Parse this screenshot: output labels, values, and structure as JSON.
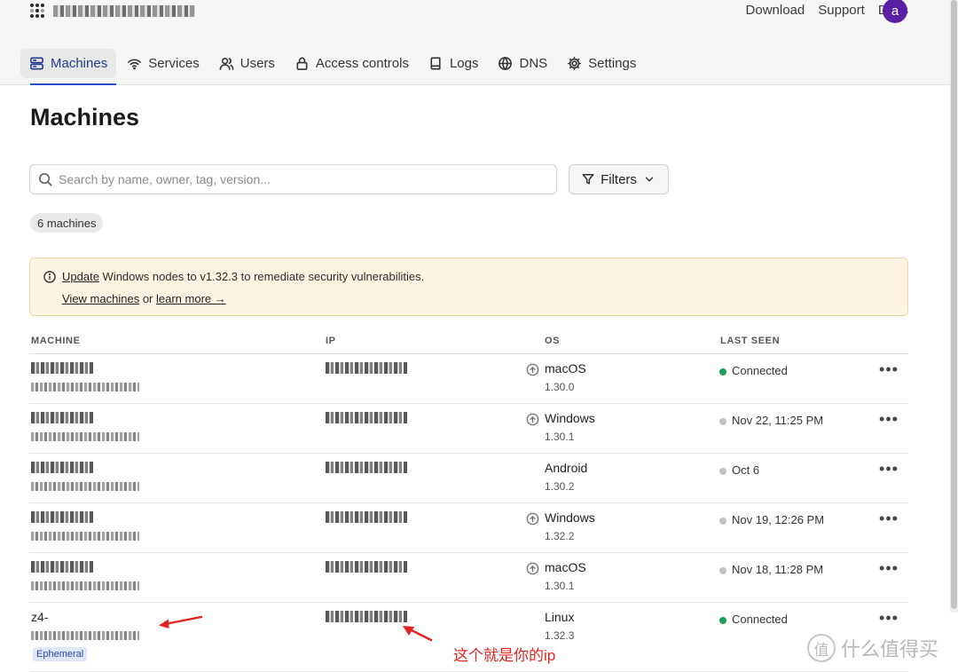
{
  "header": {
    "tailnet": "",
    "nav": [
      "Download",
      "Support",
      "Docs"
    ],
    "avatar_initial": "a"
  },
  "tabs": [
    {
      "label": "Machines",
      "icon": "server-icon",
      "active": true
    },
    {
      "label": "Services",
      "icon": "wifi-icon"
    },
    {
      "label": "Users",
      "icon": "users-icon"
    },
    {
      "label": "Access controls",
      "icon": "lock-icon"
    },
    {
      "label": "Logs",
      "icon": "book-icon"
    },
    {
      "label": "DNS",
      "icon": "globe-icon"
    },
    {
      "label": "Settings",
      "icon": "gear-icon"
    }
  ],
  "page_title": "Machines",
  "search": {
    "placeholder": "Search by name, owner, tag, version...",
    "value": ""
  },
  "filters_label": "Filters",
  "machine_count": "6 machines",
  "banner": {
    "update_link": "Update",
    "text_middle": " Windows nodes to v1.32.3",
    "text_end": " to remediate security vulnerabilities.",
    "view_machines": "View machines",
    "or": " or ",
    "learn_more": "learn more →"
  },
  "table": {
    "headers": [
      "MACHINE",
      "IP",
      "OS",
      "LAST SEEN"
    ],
    "rows": [
      {
        "name": "",
        "user": "",
        "ip": "",
        "os": "macOS",
        "version": "1.30.0",
        "update_available": true,
        "last_seen": "Connected",
        "connected": true
      },
      {
        "name": "",
        "user": "",
        "ip": "",
        "os": "Windows",
        "version": "1.30.1",
        "update_available": true,
        "last_seen": "Nov 22, 11:25 PM",
        "connected": false
      },
      {
        "name": "",
        "user": "",
        "ip": "",
        "os": "Android",
        "version": "1.30.2",
        "update_available": false,
        "last_seen": "Oct 6",
        "connected": false
      },
      {
        "name": "",
        "user": "",
        "ip": "",
        "os": "Windows",
        "version": "1.32.2",
        "update_available": true,
        "last_seen": "Nov 19, 12:26 PM",
        "connected": false
      },
      {
        "name": "",
        "user": "",
        "ip": "",
        "os": "macOS",
        "version": "1.30.1",
        "update_available": true,
        "last_seen": "Nov 18, 11:28 PM",
        "connected": false
      },
      {
        "name": "z4-",
        "user": "",
        "ip": "",
        "os": "Linux",
        "version": "1.32.3",
        "update_available": false,
        "last_seen": "Connected",
        "connected": true,
        "tag": "Ephemeral"
      }
    ]
  },
  "colors": {
    "connected": "#1a9e5c",
    "offline": "#c4c4c4",
    "accent": "#2f4fd0",
    "annotation": "#e52321",
    "avatar": "#5b1fa6"
  },
  "annotation": {
    "text": "这个就是你的ip"
  },
  "watermark": {
    "logo_char": "值",
    "text": "什么值得买"
  }
}
